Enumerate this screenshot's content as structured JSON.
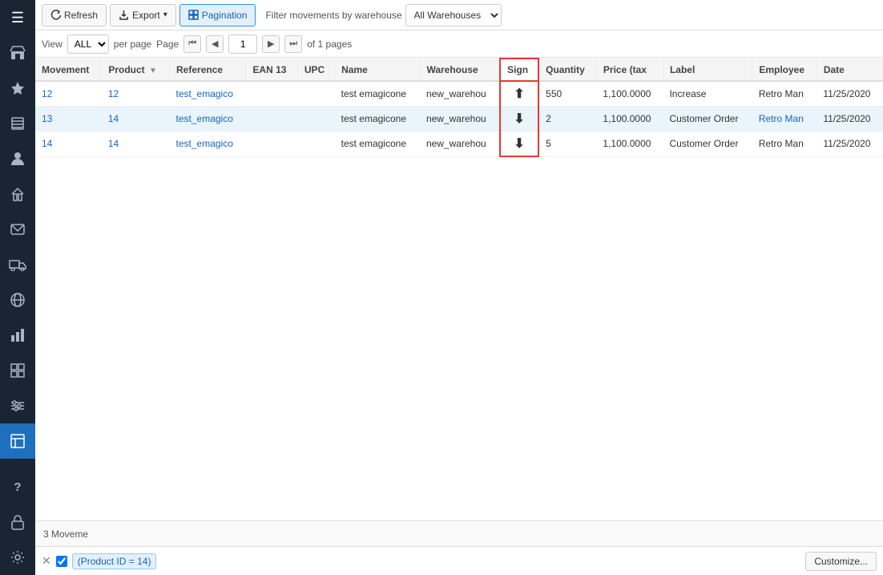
{
  "sidebar": {
    "items": [
      {
        "name": "hamburger",
        "icon": "☰",
        "active": false
      },
      {
        "name": "store",
        "icon": "🏪",
        "active": false
      },
      {
        "name": "star",
        "icon": "★",
        "active": false
      },
      {
        "name": "box",
        "icon": "📦",
        "active": false
      },
      {
        "name": "person",
        "icon": "👤",
        "active": false
      },
      {
        "name": "home",
        "icon": "🏠",
        "active": false
      },
      {
        "name": "chat",
        "icon": "💬",
        "active": false
      },
      {
        "name": "truck",
        "icon": "🚚",
        "active": false
      },
      {
        "name": "globe",
        "icon": "🌐",
        "active": false
      },
      {
        "name": "chart",
        "icon": "📊",
        "active": false
      },
      {
        "name": "puzzle",
        "icon": "🧩",
        "active": false
      },
      {
        "name": "sliders",
        "icon": "⊟",
        "active": false
      },
      {
        "name": "clipboard",
        "icon": "📋",
        "active": true
      },
      {
        "name": "question",
        "icon": "?",
        "active": false
      },
      {
        "name": "lock",
        "icon": "🔒",
        "active": false
      },
      {
        "name": "gear",
        "icon": "⚙",
        "active": false
      }
    ]
  },
  "toolbar": {
    "refresh_label": "Refresh",
    "export_label": "Export",
    "pagination_label": "Pagination",
    "filter_label": "Filter movements by warehouse",
    "filter_options": [
      "All Warehouses"
    ],
    "filter_value": "All Warehouses"
  },
  "pagination": {
    "view_label": "View",
    "per_page_label": "per page",
    "page_label": "Page",
    "of_label": "of 1 pages",
    "per_page_value": "ALL",
    "page_value": "1"
  },
  "table": {
    "columns": [
      {
        "key": "movement",
        "label": "Movement"
      },
      {
        "key": "product",
        "label": "Product"
      },
      {
        "key": "reference",
        "label": "Reference"
      },
      {
        "key": "ean13",
        "label": "EAN 13"
      },
      {
        "key": "upc",
        "label": "UPC"
      },
      {
        "key": "name",
        "label": "Name"
      },
      {
        "key": "warehouse",
        "label": "Warehouse"
      },
      {
        "key": "sign",
        "label": "Sign"
      },
      {
        "key": "quantity",
        "label": "Quantity"
      },
      {
        "key": "price",
        "label": "Price (tax"
      },
      {
        "key": "label",
        "label": "Label"
      },
      {
        "key": "employee",
        "label": "Employee"
      },
      {
        "key": "date",
        "label": "Date"
      }
    ],
    "rows": [
      {
        "movement": "12",
        "product": "12",
        "reference": "test_emagico",
        "ean13": "",
        "upc": "",
        "name": "test emagicone",
        "warehouse": "new_warehou",
        "sign": "↑",
        "sign_type": "up",
        "quantity": "550",
        "price": "1,100.0000",
        "label": "Increase",
        "employee": "Retro Man",
        "date": "11/25/2020",
        "row_style": "even"
      },
      {
        "movement": "13",
        "product": "14",
        "reference": "test_emagico",
        "ean13": "",
        "upc": "",
        "name": "test emagicone",
        "warehouse": "new_warehou",
        "sign": "↓",
        "sign_type": "down",
        "quantity": "2",
        "price": "1,100.0000",
        "label": "Customer Order",
        "employee": "Retro Man",
        "date": "11/25/2020",
        "row_style": "odd"
      },
      {
        "movement": "14",
        "product": "14",
        "reference": "test_emagico",
        "ean13": "",
        "upc": "",
        "name": "test emagicone",
        "warehouse": "new_warehou",
        "sign": "↓",
        "sign_type": "down",
        "quantity": "5",
        "price": "1,100.0000",
        "label": "Customer Order",
        "employee": "Retro Man",
        "date": "11/25/2020",
        "row_style": "even"
      }
    ]
  },
  "status_bar": {
    "count_label": "3 Moveme"
  },
  "filter_bar": {
    "tag_text": "(Product ID = 14)",
    "customize_label": "Customize..."
  }
}
